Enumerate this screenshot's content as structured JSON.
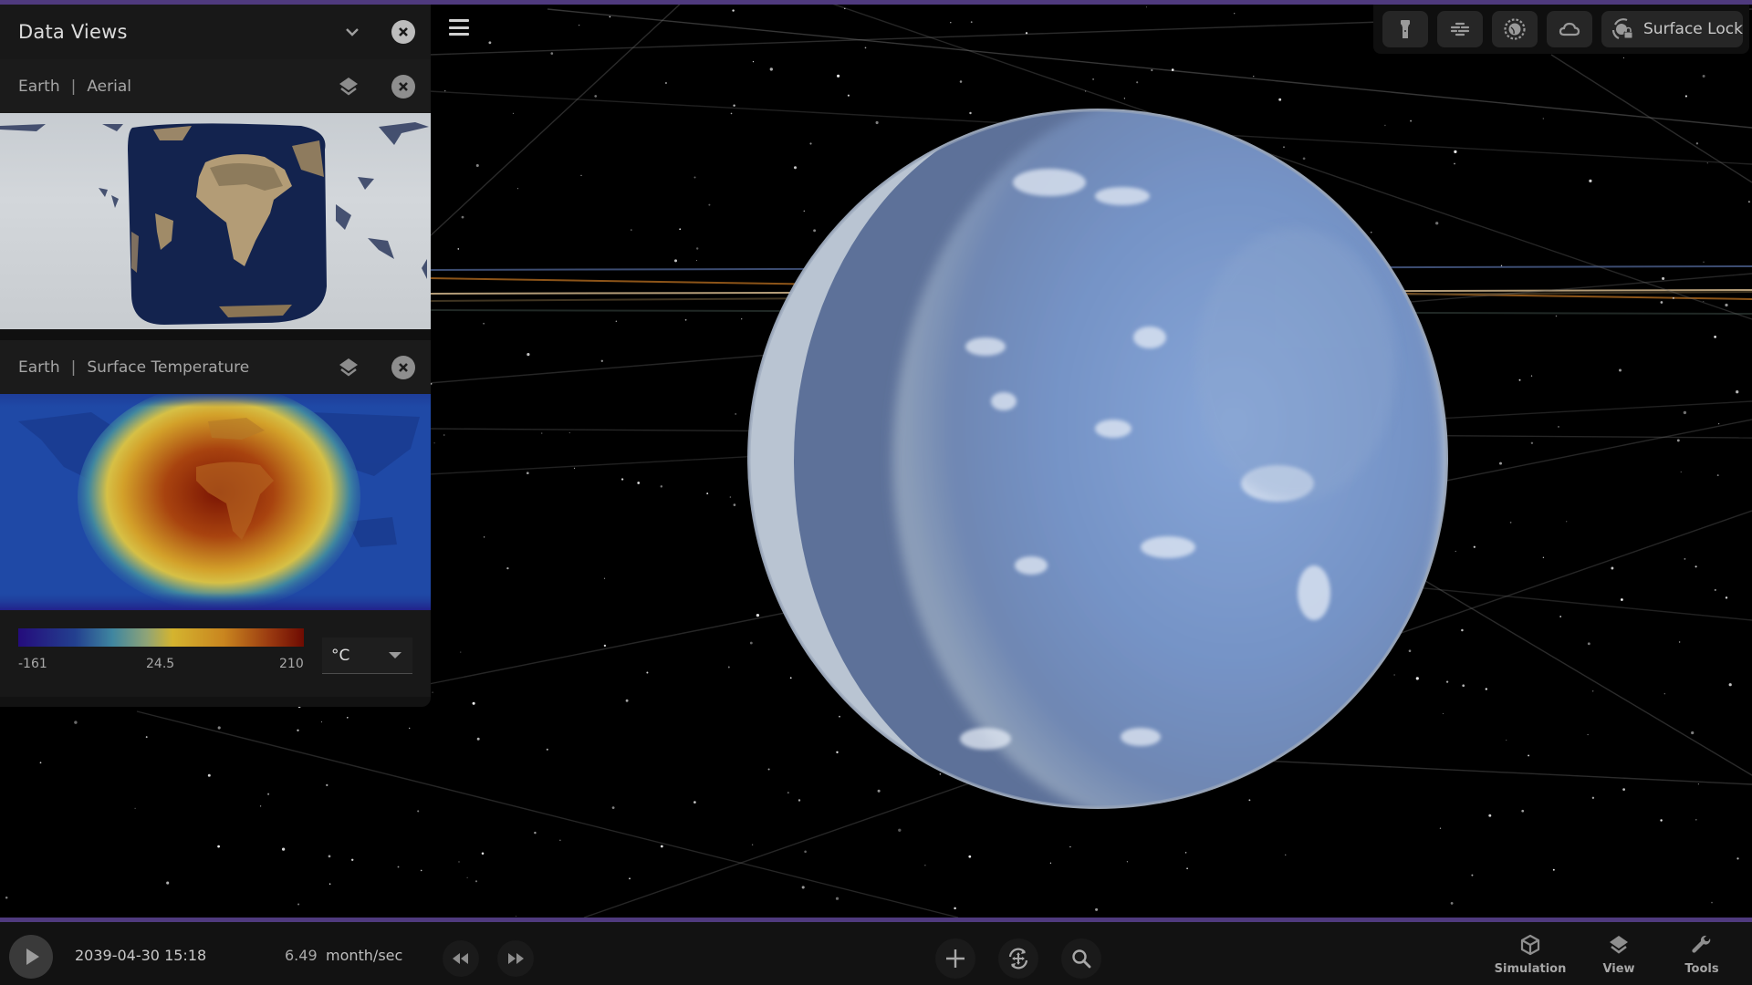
{
  "app": {
    "accent_color": "#4f3a7e"
  },
  "data_views": {
    "title": "Data Views",
    "collapse_icon": "chevron-down-icon",
    "close_icon": "close-circle-icon",
    "views": [
      {
        "body": "Earth",
        "separator": "|",
        "layer": "Aerial",
        "layers_icon": "layers-icon",
        "close_icon": "close-circle-icon"
      },
      {
        "body": "Earth",
        "separator": "|",
        "layer": "Surface Temperature",
        "layers_icon": "layers-icon",
        "close_icon": "close-circle-icon",
        "legend": {
          "min": "-161",
          "mid": "24.5",
          "max": "210",
          "colors": [
            "#240c7c",
            "#23408f",
            "#3f86a0",
            "#8fa477",
            "#d4b42f",
            "#c9851f",
            "#9a3a10",
            "#6e0b02"
          ],
          "unit_selected": "°C"
        }
      }
    ]
  },
  "menu": {
    "icon": "hamburger-menu-icon"
  },
  "top_toolbar": {
    "buttons": [
      {
        "icon": "flashlight-icon",
        "label": ""
      },
      {
        "icon": "orbit-lines-icon",
        "label": ""
      },
      {
        "icon": "atmosphere-icon",
        "label": ""
      },
      {
        "icon": "cloud-icon",
        "label": ""
      },
      {
        "icon": "surface-lock-icon",
        "label": "Surface Lock"
      }
    ]
  },
  "time_controls": {
    "play_icon": "play-icon",
    "datetime": "2039-04-30 15:18",
    "rate_value": "6.49",
    "rate_unit": "month/sec",
    "rewind_icon": "rewind-icon",
    "fast_forward_icon": "fast-forward-icon"
  },
  "camera_controls": {
    "add_icon": "plus-icon",
    "recenter_icon": "recenter-move-icon",
    "search_icon": "search-icon"
  },
  "nav_tabs": [
    {
      "label": "Simulation",
      "icon": "cube-icon"
    },
    {
      "label": "View",
      "icon": "layers-icon"
    },
    {
      "label": "Tools",
      "icon": "wrench-icon"
    }
  ],
  "scene": {
    "planet": "Earth",
    "orbit_line_colors": [
      "#c7ad86",
      "#b0691e",
      "#4b5f8e",
      "#5a4a30",
      "#2e3a36",
      "#6d6d6d"
    ]
  }
}
